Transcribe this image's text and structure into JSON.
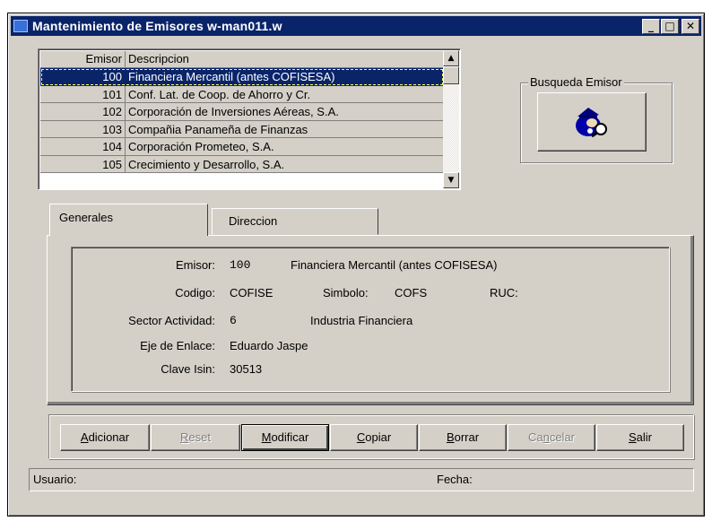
{
  "window": {
    "title": "Mantenimiento de Emisores w-man011.w",
    "min_glyph": "_",
    "max_glyph": "□",
    "close_glyph": "✕"
  },
  "grid": {
    "columns": [
      "Emisor",
      "Descripcion"
    ],
    "rows": [
      {
        "emisor": "100",
        "descripcion": "Financiera Mercantil (antes COFISESA)"
      },
      {
        "emisor": "101",
        "descripcion": "Conf. Lat. de Coop. de Ahorro y Cr."
      },
      {
        "emisor": "102",
        "descripcion": "Corporación de Inversiones Aéreas, S.A."
      },
      {
        "emisor": "103",
        "descripcion": "Compañia Panameña de Finanzas"
      },
      {
        "emisor": "104",
        "descripcion": "Corporación Prometeo, S.A."
      },
      {
        "emisor": "105",
        "descripcion": "Crecimiento y Desarrollo, S.A."
      }
    ],
    "selected_index": 0,
    "scroll_up": "▲",
    "scroll_down": "▼"
  },
  "search": {
    "legend": "Busqueda Emisor",
    "icon": "detective-search-icon"
  },
  "tabs": [
    {
      "label": "Generales",
      "active": true
    },
    {
      "label": "Direccion",
      "active": false
    }
  ],
  "form": {
    "emisor_label": "Emisor:",
    "emisor_code": "100",
    "emisor_name": "Financiera Mercantil (antes COFISESA)",
    "codigo_label": "Codigo:",
    "codigo_value": "COFISE",
    "simbolo_label": "Simbolo:",
    "simbolo_value": "COFS",
    "ruc_label": "RUC:",
    "ruc_value": "",
    "sector_label": "Sector Actividad:",
    "sector_code": "6",
    "sector_name": "Industria Financiera",
    "eje_label": "Eje de Enlace:",
    "eje_value": "Eduardo Jaspe",
    "isin_label": "Clave Isin:",
    "isin_value": "30513"
  },
  "buttons": {
    "adicionar": {
      "first": "A",
      "rest": "dicionar"
    },
    "reset": {
      "first": "R",
      "rest": "eset"
    },
    "modificar": {
      "first": "M",
      "rest": "odificar"
    },
    "copiar": {
      "first": "C",
      "rest": "opiar"
    },
    "borrar": {
      "first": "B",
      "rest": "orrar"
    },
    "cancelar": {
      "pre": "Ca",
      "u": "n",
      "post": "celar"
    },
    "salir": {
      "first": "S",
      "rest": "alir"
    }
  },
  "status": {
    "usuario_label": "Usuario:",
    "fecha_label": "Fecha:"
  },
  "colors": {
    "face": "#d4d0c8",
    "titlebar": "#0a246a",
    "selection": "#0a246a"
  }
}
